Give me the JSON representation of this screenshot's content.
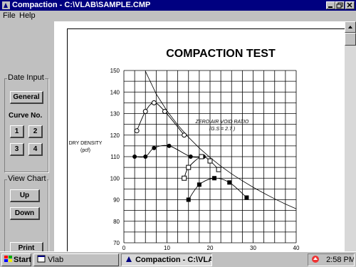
{
  "window": {
    "title": "Compaction - C:\\VLAB\\SAMPLE.CMP"
  },
  "menu": {
    "file": "File",
    "help": "Help"
  },
  "left_panel": {
    "date_input": {
      "label": "Date Input",
      "general": "General",
      "curve_label": "Curve No.",
      "curves": [
        "1",
        "2",
        "3",
        "4"
      ]
    },
    "view_chart": {
      "label": "View Chart",
      "up": "Up",
      "down": "Down"
    },
    "print": "Print"
  },
  "taskbar": {
    "start": "Start",
    "vlab": "Vlab",
    "compaction": "Compaction - C:\\VLA...",
    "clock": "2:58 PM"
  },
  "chart_data": {
    "type": "scatter",
    "title": "COMPACTION TEST",
    "ylabel_line1": "DRY DENSITY",
    "ylabel_line2": "(pcf)",
    "xlim": [
      0,
      40
    ],
    "ylim": [
      70,
      150
    ],
    "xticks": [
      0,
      10,
      20,
      30,
      40
    ],
    "yticks": [
      70,
      80,
      90,
      100,
      110,
      120,
      130,
      140,
      150
    ],
    "grid": true,
    "annotation_line1": "ZERO AIR VOID RATIO",
    "annotation_line2": "(G.S = 2.7 )",
    "zav_curve": {
      "x": [
        5,
        7.5,
        10,
        12.5,
        15,
        17.5,
        20,
        22.5,
        25,
        27.5,
        30,
        32.5,
        35,
        37.5,
        40
      ],
      "y": [
        149.6,
        139.1,
        131.3,
        124.7,
        119.0,
        114.0,
        109.6,
        105.6,
        102.0,
        98.8,
        95.8,
        93.0,
        90.4,
        88.0,
        85.8
      ]
    },
    "series": [
      {
        "marker": "open-circle",
        "x": [
          3,
          5,
          7,
          9.5,
          14
        ],
        "y": [
          122,
          131,
          135,
          131,
          120
        ]
      },
      {
        "marker": "filled-circle",
        "x": [
          2.5,
          5,
          7,
          10.5,
          15.5,
          18.5
        ],
        "y": [
          110,
          110,
          114,
          115,
          110,
          110
        ]
      },
      {
        "marker": "open-square",
        "x": [
          14,
          15,
          18,
          20,
          22
        ],
        "y": [
          100,
          105,
          110,
          108,
          104
        ]
      },
      {
        "marker": "filled-square",
        "x": [
          15,
          17.5,
          21,
          24.5,
          28.5
        ],
        "y": [
          90,
          97,
          100,
          98,
          91
        ]
      }
    ]
  }
}
